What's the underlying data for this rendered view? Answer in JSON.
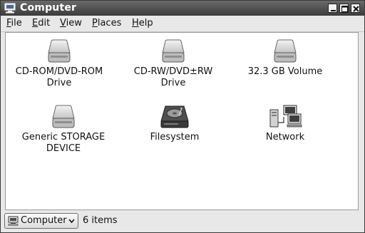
{
  "window": {
    "title": "Computer",
    "icon": "computer-icon",
    "controls": [
      "minimize-icon",
      "maximize-icon",
      "close-icon"
    ]
  },
  "menubar": {
    "items": [
      {
        "label": "File",
        "mnemonic": "F",
        "rest": "ile"
      },
      {
        "label": "Edit",
        "mnemonic": "E",
        "rest": "dit"
      },
      {
        "label": "View",
        "mnemonic": "V",
        "rest": "iew"
      },
      {
        "label": "Places",
        "mnemonic": "P",
        "rest": "laces"
      },
      {
        "label": "Help",
        "mnemonic": "H",
        "rest": "elp"
      }
    ]
  },
  "items": [
    {
      "label": "CD-ROM/DVD-ROM Drive",
      "line1": "CD-ROM/DVD-ROM",
      "line2": "Drive",
      "icon": "optical-drive-icon"
    },
    {
      "label": "CD-RW/DVD±RW Drive",
      "line1": "CD-RW/DVD±RW",
      "line2": "Drive",
      "icon": "optical-drive-icon"
    },
    {
      "label": "32.3 GB Volume",
      "line1": "32.3 GB Volume",
      "line2": "",
      "icon": "drive-icon"
    },
    {
      "label": "Generic STORAGE DEVICE",
      "line1": "Generic STORAGE",
      "line2": "DEVICE",
      "icon": "drive-icon"
    },
    {
      "label": "Filesystem",
      "line1": "Filesystem",
      "line2": "",
      "icon": "harddisk-icon"
    },
    {
      "label": "Network",
      "line1": "Network",
      "line2": "",
      "icon": "network-icon"
    }
  ],
  "statusbar": {
    "location": "Computer",
    "location_icon": "computer-icon",
    "count_text": "6 items"
  }
}
